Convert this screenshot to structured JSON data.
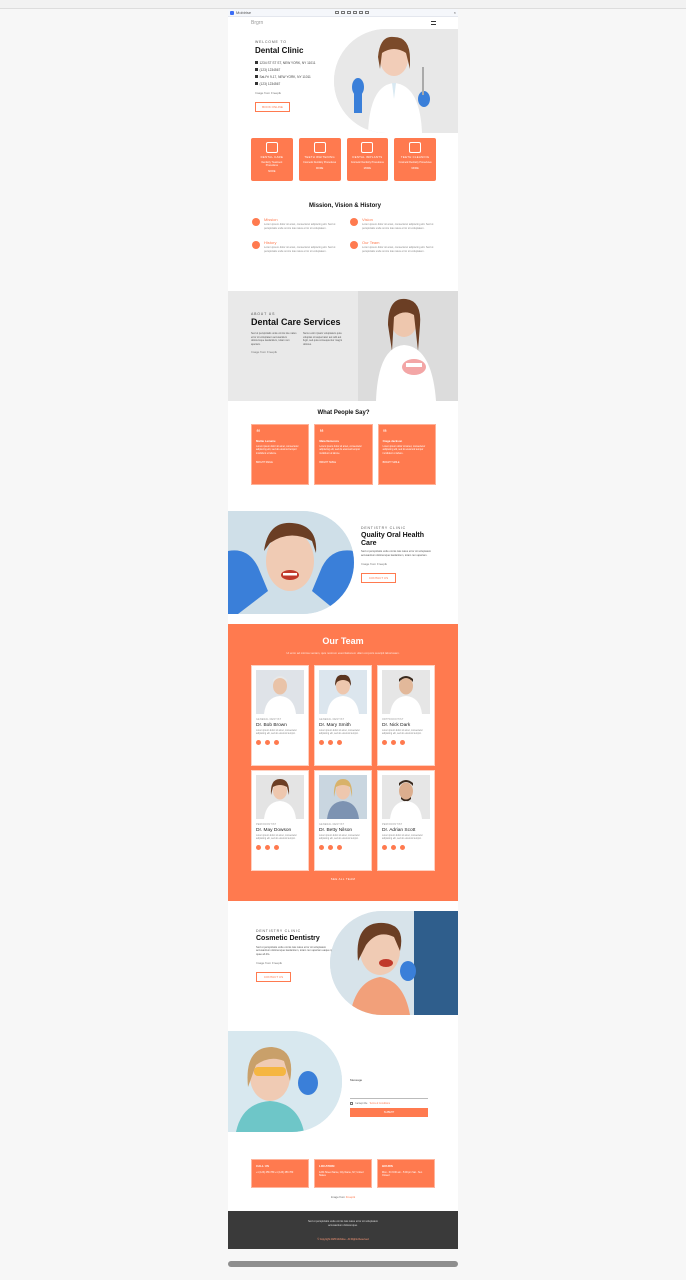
{
  "editor": {
    "app": "Mobirise",
    "devices": [
      "mobile",
      "tablet",
      "desktop",
      "wide",
      "fit",
      "full"
    ]
  },
  "nav": {
    "brand": "Brgrn"
  },
  "hero": {
    "eyebrow": "WELCOME TO",
    "title": "Dental Clinic",
    "lines": [
      "1234 ST ST ST, NEW YORK, NY 11011",
      "(123) 1234567",
      "Sat-Fri 9-17, NEW YORK, NY 11011",
      "(123) 1234567"
    ],
    "credit": "Image from Freepik",
    "button": "BOOK ONLINE"
  },
  "features": [
    {
      "title": "DENTAL CARE",
      "desc": "Dentistry Treatment Procedures",
      "more": "MORE"
    },
    {
      "title": "TEETH WHITENING",
      "desc": "Cosmetic Dentistry Procedures",
      "more": "MORE"
    },
    {
      "title": "DENTAL IMPLANTS",
      "desc": "Cosmetic Dentistry Procedures",
      "more": "MORE"
    },
    {
      "title": "TEETH CLEANING",
      "desc": "Cosmetic Dentistry Procedures",
      "more": "MORE"
    }
  ],
  "mission": {
    "title": "Mission, Vision & History",
    "items": [
      {
        "title": "Mission",
        "body": "Lorem ipsum dolor sit amet, consectetur adipiscing elit. Sed ut perspiciatis unde omnis iste natus error sit voluptatem."
      },
      {
        "title": "Vision",
        "body": "Lorem ipsum dolor sit amet, consectetur adipiscing elit. Sed ut perspiciatis unde omnis iste natus error sit voluptatem."
      },
      {
        "title": "History",
        "body": "Lorem ipsum dolor sit amet, consectetur adipiscing elit. Sed ut perspiciatis unde omnis iste natus error sit voluptatem."
      },
      {
        "title": "Our Team",
        "body": "Lorem ipsum dolor sit amet, consectetur adipiscing elit. Sed ut perspiciatis unde omnis iste natus error sit voluptatem."
      }
    ]
  },
  "about": {
    "eyebrow": "ABOUT US",
    "title": "Dental Care Services",
    "col1": "Sed ut perspiciatis unde omnis iste natus error sit voluptatem accusantium doloremque laudantium, totam rem aperiam.",
    "col2": "Nemo enim ipsam voluptatem quia voluptas sit aspernatur aut odit aut fugit, sed quia consequuntur magni dolores.",
    "credit": "Image from Freepik"
  },
  "testimonials": {
    "title": "What People Say?",
    "items": [
      {
        "name": "Mattie Lemaire",
        "body": "Lorem ipsum dolor sit amet, consectetur adipiscing elit, sed do eiusmod tempor incididunt ut labore.",
        "role": "BRIGHT SMILE"
      },
      {
        "name": "Maia Nemonov",
        "body": "Lorem ipsum dolor sit amet, consectetur adipiscing elit, sed do eiusmod tempor incididunt ut labore.",
        "role": "BRIGHT SMILE"
      },
      {
        "name": "Ciaga Jackson",
        "body": "Lorem ipsum dolor sit amet, consectetur adipiscing elit, sed do eiusmod tempor incididunt ut labore.",
        "role": "BRIGHT SMILE"
      }
    ]
  },
  "quality": {
    "eyebrow": "DENTISTRY CLINIC",
    "title": "Quality Oral Health Care",
    "body": "Sed ut perspiciatis unde omnis iste natus error sit voluptatem accusantium doloremque laudantium, totam rem aperiam.",
    "credit": "Image from Freepik",
    "button": "CONTACT US"
  },
  "team": {
    "title": "Our Team",
    "subtitle": "Ut enim ad minima veniam, quis nostrum exercitationem ullam corporis suscipit laboriosam.",
    "members": [
      {
        "role": "GENERAL DENTIST",
        "name": "Dr. Bob Brown",
        "desc": "Lorem ipsum dolor sit amet, consectetur adipiscing elit, sed do eiusmod tempor."
      },
      {
        "role": "GENERAL DENTIST",
        "name": "Dr. Mary Smith",
        "desc": "Lorem ipsum dolor sit amet, consectetur adipiscing elit, sed do eiusmod tempor."
      },
      {
        "role": "ORTHODONTIST",
        "name": "Dr. Nick Dark",
        "desc": "Lorem ipsum dolor sit amet, consectetur adipiscing elit, sed do eiusmod tempor."
      },
      {
        "role": "PERIODONTIST",
        "name": "Dr. May Dowson",
        "desc": "Lorem ipsum dolor sit amet, consectetur adipiscing elit, sed do eiusmod tempor."
      },
      {
        "role": "GENERAL DENTIST",
        "name": "Dr. Betty Nilson",
        "desc": "Lorem ipsum dolor sit amet, consectetur adipiscing elit, sed do eiusmod tempor."
      },
      {
        "role": "PERIODONTIST",
        "name": "Dr. Adrian Scott",
        "desc": "Lorem ipsum dolor sit amet, consectetur adipiscing elit, sed do eiusmod tempor."
      }
    ],
    "link": "SEE ALL TEAM"
  },
  "cosmetic": {
    "eyebrow": "DENTISTRY CLINIC",
    "title": "Cosmetic Dentistry",
    "body": "Sed ut perspiciatis unde omnis iste natus error sit voluptatem accusantium doloremque laudantium, totam rem aperiam eaque ipsa quae ab illo.",
    "credit": "Image from Freepik",
    "button": "CONTACT US"
  },
  "contact": {
    "message_label": "Message",
    "checkbox_label": "I accept the",
    "checkbox_link": "Terms & Conditions",
    "submit": "SUBMIT"
  },
  "info": [
    {
      "title": "CALL US",
      "value": "+1 (123) 456 789\n+1 (123) 456 780"
    },
    {
      "title": "LOCATION",
      "value": "1234 Street Name, City Name, NY, United States"
    },
    {
      "title": "HOURS",
      "value": "Mon - Fri 9:00 am - 5:00 pm\nSat - Sun Closed"
    }
  ],
  "credit": {
    "prefix": "Image from",
    "link": "Freepik"
  },
  "footer": {
    "text": "Sed ut perspiciatis unde omnis iste natus error sit voluptatem accusantium doloremque.",
    "copyright": "© Copyright 2025 Mobirise - All Rights Reserved"
  },
  "colors": {
    "accent": "#ff7a4f",
    "footer": "#3a3a3a"
  }
}
